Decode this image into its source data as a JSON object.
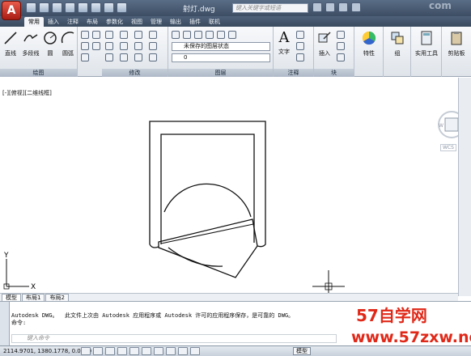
{
  "titlebar": {
    "logo_letter": "A",
    "doc_title": "射灯.dwg",
    "search_placeholder": "键入关键字或短语",
    "watermark": "com"
  },
  "tabs": [
    "常用",
    "插入",
    "注释",
    "布局",
    "参数化",
    "视图",
    "管理",
    "输出",
    "插件",
    "联机"
  ],
  "active_tab": "常用",
  "ribbon": {
    "draw": {
      "label": "绘图",
      "line": "直线",
      "polyline": "多段线",
      "circle": "圆",
      "arc": "圆弧"
    },
    "modify": {
      "label": "修改"
    },
    "layers": {
      "label": "图层",
      "layer_state": "未保存的图层状态",
      "current_layer": "0"
    },
    "annotation": {
      "label": "注释",
      "text": "文字"
    },
    "block": {
      "label": "块",
      "insert": "插入"
    },
    "properties": {
      "label": "特性"
    },
    "groups": {
      "label": "组"
    },
    "utilities": {
      "label": "实用工具"
    },
    "clipboard": {
      "label": "剪贴板"
    }
  },
  "viewport_label": "[-][俯视][二维线框]",
  "viewcube": {
    "wcs": "WCS"
  },
  "ucs": {
    "y": "Y",
    "x": "X"
  },
  "layout_tabs": [
    "模型",
    "布局1",
    "布局2"
  ],
  "command": {
    "history_line1": "Autodesk DWG。  此文件上次由 Autodesk 应用程序或 Autodesk 许可的应用程序保存，是可靠的 DWG。",
    "history_line2": "命令:",
    "input_placeholder": "键入命令"
  },
  "brand": {
    "line1": "57自学网",
    "line2": "www.57zxw.net"
  },
  "status": {
    "coords": "2114.9701, 1380.1778, 0.0000",
    "model": "模型"
  },
  "colors": {
    "logo_red": "#c3281c",
    "brand_red": "#e02818",
    "titlebar": "#46576d"
  }
}
